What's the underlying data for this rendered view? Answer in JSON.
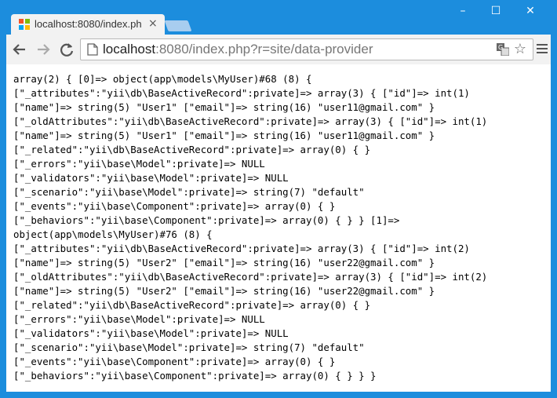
{
  "browser": {
    "tab_title": "localhost:8080/index.ph",
    "tab_close": "×",
    "url_host": "localhost",
    "url_rest": ":8080/index.php?r=site/data-provider",
    "win_minimize": "–",
    "win_maximize": "☐",
    "win_close": "✕",
    "star_glyph": "☆"
  },
  "colors": {
    "window_frame": "#1c8ddd",
    "toolbar": "#f2f2f2"
  },
  "icons": [
    "favicon-icon",
    "back-arrow-icon",
    "forward-arrow-icon",
    "reload-icon",
    "page-icon",
    "translate-icon",
    "star-icon",
    "menu-icon"
  ],
  "output_lines": [
    "array(2) { [0]=> object(app\\models\\MyUser)#68 (8) {",
    "[\"_attributes\":\"yii\\db\\BaseActiveRecord\":private]=> array(3) { [\"id\"]=> int(1)",
    "[\"name\"]=> string(5) \"User1\" [\"email\"]=> string(16) \"user11@gmail.com\" }",
    "[\"_oldAttributes\":\"yii\\db\\BaseActiveRecord\":private]=> array(3) { [\"id\"]=> int(1)",
    "[\"name\"]=> string(5) \"User1\" [\"email\"]=> string(16) \"user11@gmail.com\" }",
    "[\"_related\":\"yii\\db\\BaseActiveRecord\":private]=> array(0) { }",
    "[\"_errors\":\"yii\\base\\Model\":private]=> NULL",
    "[\"_validators\":\"yii\\base\\Model\":private]=> NULL",
    "[\"_scenario\":\"yii\\base\\Model\":private]=> string(7) \"default\"",
    "[\"_events\":\"yii\\base\\Component\":private]=> array(0) { }",
    "[\"_behaviors\":\"yii\\base\\Component\":private]=> array(0) { } } [1]=>",
    "object(app\\models\\MyUser)#76 (8) {",
    "[\"_attributes\":\"yii\\db\\BaseActiveRecord\":private]=> array(3) { [\"id\"]=> int(2)",
    "[\"name\"]=> string(5) \"User2\" [\"email\"]=> string(16) \"user22@gmail.com\" }",
    "[\"_oldAttributes\":\"yii\\db\\BaseActiveRecord\":private]=> array(3) { [\"id\"]=> int(2)",
    "[\"name\"]=> string(5) \"User2\" [\"email\"]=> string(16) \"user22@gmail.com\" }",
    "[\"_related\":\"yii\\db\\BaseActiveRecord\":private]=> array(0) { }",
    "[\"_errors\":\"yii\\base\\Model\":private]=> NULL",
    "[\"_validators\":\"yii\\base\\Model\":private]=> NULL",
    "[\"_scenario\":\"yii\\base\\Model\":private]=> string(7) \"default\"",
    "[\"_events\":\"yii\\base\\Component\":private]=> array(0) { }",
    "[\"_behaviors\":\"yii\\base\\Component\":private]=> array(0) { } } }"
  ]
}
